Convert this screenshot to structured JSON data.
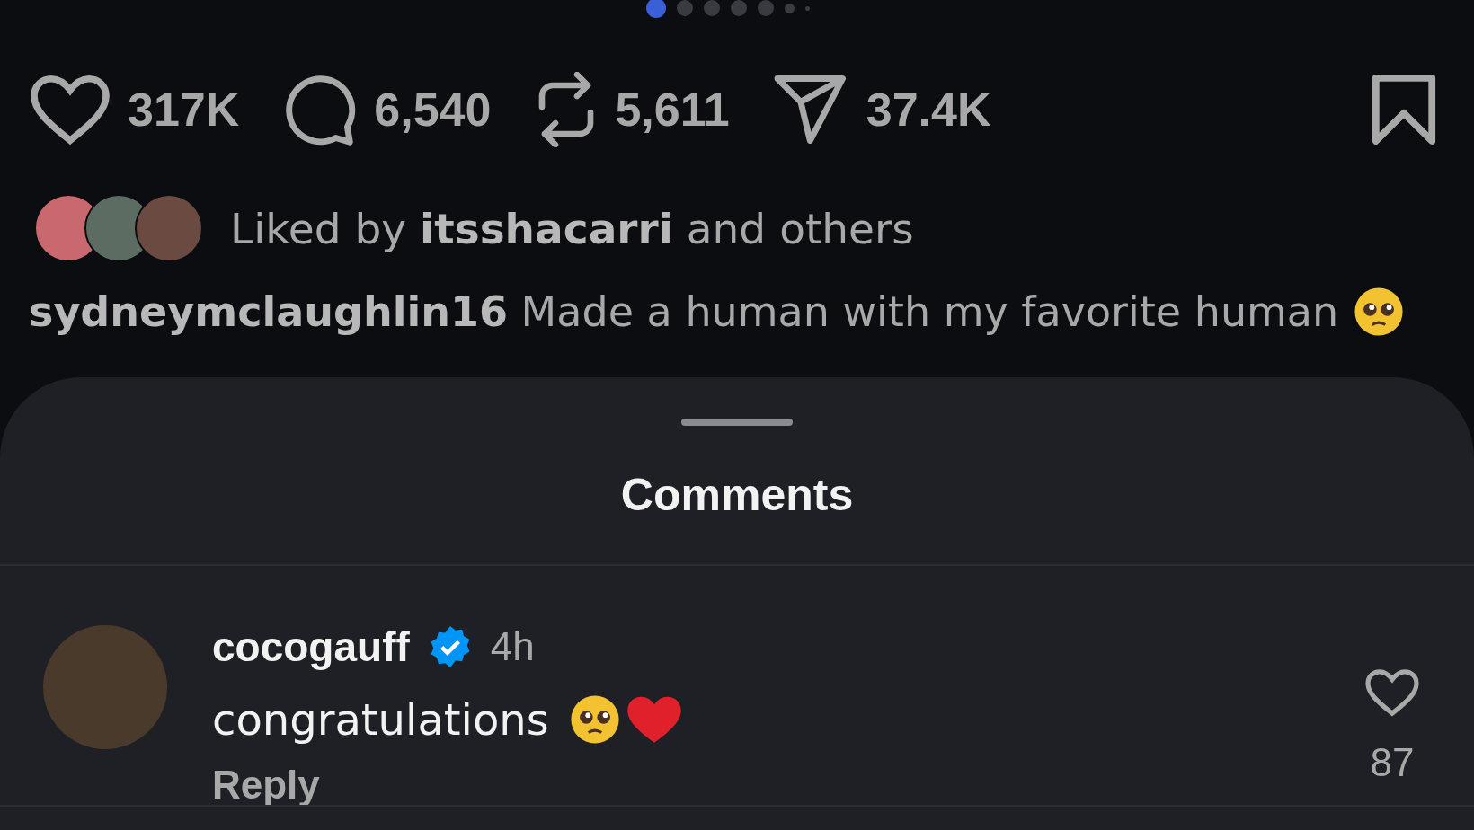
{
  "carousel_dots": [
    {
      "selected": true
    },
    {
      "selected": false
    },
    {
      "selected": false
    },
    {
      "selected": false
    },
    {
      "selected": false
    },
    {
      "selected": false
    },
    {
      "selected": false
    }
  ],
  "actions": [
    {
      "kind": "like",
      "count": "317K"
    },
    {
      "kind": "comment",
      "count": "6,540"
    },
    {
      "kind": "repost",
      "count": "5,611"
    },
    {
      "kind": "share",
      "count": "37.4K"
    }
  ],
  "saved": false,
  "liked_by": {
    "prefix": "Liked by",
    "user": "itsshacarri",
    "suffix": "and others"
  },
  "caption": {
    "user": "sydneymclaughlin16",
    "text": "Made a human with my favorite human"
  },
  "sheet": {
    "title": "Comments"
  },
  "comments": [
    {
      "user": "cocogauff",
      "verified": true,
      "time": "4h",
      "text": "congratulations",
      "reply": "Reply",
      "likes": "87",
      "liked": false
    }
  ]
}
